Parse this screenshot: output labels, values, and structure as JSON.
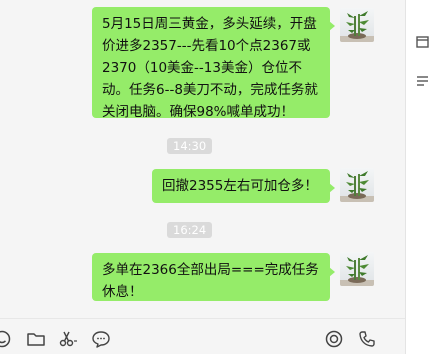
{
  "messages": [
    {
      "text": "5月15日周三黄金，多头延续，开盘价进多2357---先看10个点2367或2370（10美金--13美金）仓位不动。任务6--8美刀不动，完成任务就关闭电脑。确保98%喊单成功！"
    },
    {
      "time": "14:30",
      "text": "回撤2355左右可加仓多！"
    },
    {
      "time": "16:24",
      "text": "多单在2366全部出局===完成任务休息！"
    }
  ],
  "toolbar": [
    "emoji-icon",
    "folder-icon",
    "scissors-icon",
    "chat-bubble-icon",
    "video-call-icon",
    "phone-icon"
  ],
  "colors": {
    "bubble": "#95ec69",
    "background": "#f5f5f5"
  }
}
